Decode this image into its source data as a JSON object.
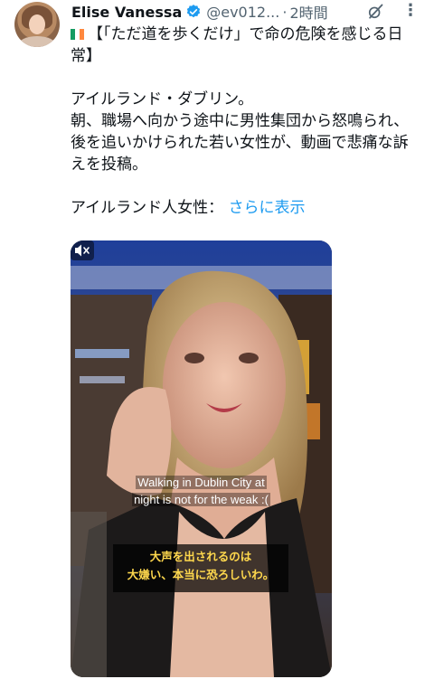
{
  "tweet": {
    "author_name": "Elise Vanessa",
    "handle": "@ev012...",
    "separator": "·",
    "time": "2時間",
    "line1": "【「ただ道を歩くだけ」で命の危険を感じる日常】",
    "line2": "アイルランド・ダブリン。",
    "line3": "朝、職場へ向かう途中に男性集団から怒鳴られ、後を追いかけられた若い女性が、動画で悲痛な訴えを投稿。",
    "line4_prefix": "アイルランド人女性：",
    "show_more": "さらに表示"
  },
  "video": {
    "caption_en_1": "Walking in Dublin City at",
    "caption_en_2": "night is not for the weak :(",
    "caption_ja_1": "大声を出されるのは",
    "caption_ja_2": "大嫌い、本当に恐ろしいわ。"
  },
  "icons": {
    "verified": "verified-badge-icon",
    "grok": "grok-icon",
    "more": "more-options-icon",
    "mute": "muted-speaker-icon",
    "flag": "ireland-flag-icon"
  },
  "colors": {
    "link": "#1d9bf0",
    "secondary_text": "#536471",
    "caption_yellow": "#ffd84d",
    "flag_green": "#169b62",
    "flag_white": "#ffffff",
    "flag_orange": "#ff883e"
  }
}
